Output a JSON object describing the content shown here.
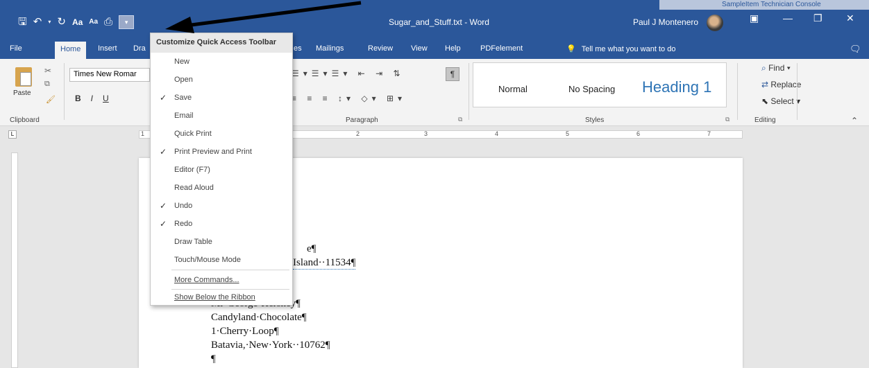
{
  "window": {
    "doc_title": "Sugar_and_Stuff.txt  -  Word",
    "user_name": "Paul J Montenero",
    "background_strip_text": "SampleItem Technician Console"
  },
  "qat": {
    "save_icon": "save-icon",
    "undo_icon": "undo-icon",
    "redo_icon": "redo-icon",
    "font_grow": "Aa",
    "font_shrink": "Aa",
    "print_preview_icon": "print-preview-icon",
    "customize_glyph": "▾"
  },
  "tabs": {
    "file": "File",
    "home": "Home",
    "insert": "Insert",
    "draw": "Dra",
    "references": "es",
    "mailings": "Mailings",
    "review": "Review",
    "view": "View",
    "help": "Help",
    "pdfelement": "PDFelement",
    "tell_me": "Tell me what you want to do"
  },
  "ribbon": {
    "paste_label": "Paste",
    "font_name": "Times New Romar",
    "bold": "B",
    "italic": "I",
    "underline": "U",
    "clipboard_label": "Clipboard",
    "paragraph_label": "Paragraph",
    "styles_label": "Styles",
    "editing_label": "Editing",
    "style_normal": "Normal",
    "style_no_spacing": "No Spacing",
    "style_heading1": "Heading 1",
    "find": "Find",
    "replace": "Replace",
    "select": "Select",
    "pilcrow": "¶"
  },
  "ruler": {
    "marks": [
      "1",
      "2",
      "3",
      "4",
      "5",
      "6",
      "7"
    ]
  },
  "menu": {
    "header": "Customize Quick Access Toolbar",
    "items": [
      {
        "label": "New",
        "checked": false
      },
      {
        "label": "Open",
        "checked": false
      },
      {
        "label": "Save",
        "checked": true
      },
      {
        "label": "Email",
        "checked": false
      },
      {
        "label": "Quick Print",
        "checked": false
      },
      {
        "label": "Print Preview and Print",
        "checked": true
      },
      {
        "label": "Editor (F7)",
        "checked": false
      },
      {
        "label": "Read Aloud",
        "checked": false
      },
      {
        "label": "Undo",
        "checked": true
      },
      {
        "label": "Redo",
        "checked": true
      },
      {
        "label": "Draw Table",
        "checked": false
      },
      {
        "label": "Touch/Mouse Mode",
        "checked": false
      }
    ],
    "more_commands": "More Commands...",
    "show_below": "Show Below the Ribbon",
    "check_glyph": "✓"
  },
  "document": {
    "lines": [
      "e¶",
      "Island··11534¶",
      "Mr·George·Hershey¶",
      "Candyland·Chocolate¶",
      "1·Cherry·Loop¶",
      "Batavia,·New·York··10762¶",
      "¶"
    ]
  }
}
